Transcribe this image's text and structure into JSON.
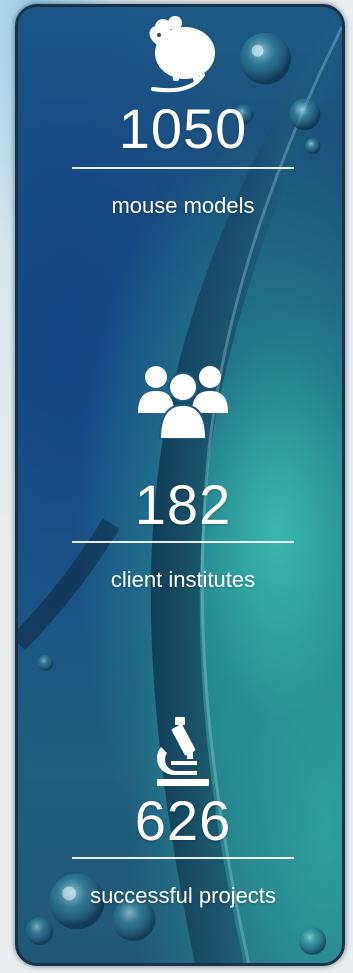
{
  "stats": [
    {
      "icon": "mouse-icon",
      "value": "1050",
      "label": "mouse models"
    },
    {
      "icon": "group-icon",
      "value": "182",
      "label": "client institutes"
    },
    {
      "icon": "microscope-icon",
      "value": "626",
      "label": "successful projects"
    }
  ],
  "colors": {
    "panel_blue": "#1b4e78",
    "panel_teal": "#3cbeaf",
    "border": "#1a3346",
    "text": "#ffffff"
  }
}
